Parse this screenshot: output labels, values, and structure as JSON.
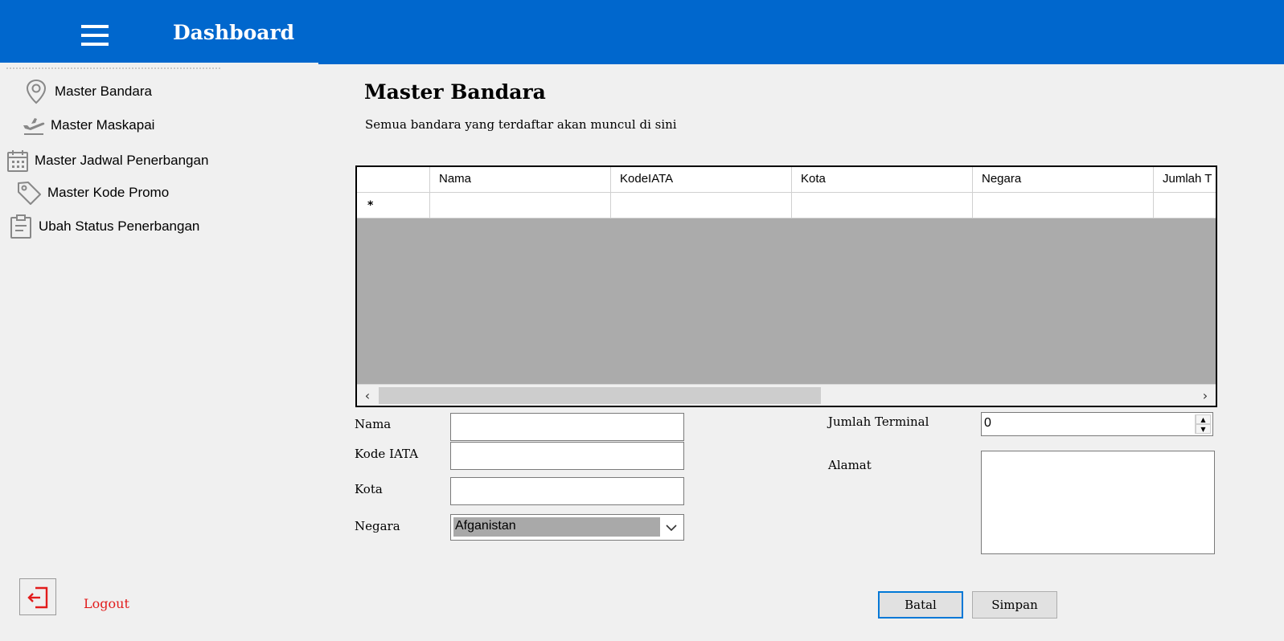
{
  "header": {
    "title": "Dashboard"
  },
  "sidebar": {
    "items": [
      {
        "label": "Master Bandara",
        "icon": "location-pin-icon"
      },
      {
        "label": "Master Maskapai",
        "icon": "plane-departure-icon"
      },
      {
        "label": "Master Jadwal Penerbangan",
        "icon": "calendar-icon"
      },
      {
        "label": "Master Kode Promo",
        "icon": "tag-icon"
      },
      {
        "label": "Ubah Status Penerbangan",
        "icon": "clipboard-icon"
      }
    ],
    "logout_label": "Logout"
  },
  "main": {
    "title": "Master Bandara",
    "subtitle": "Semua bandara yang terdaftar akan muncul di sini",
    "grid": {
      "columns": [
        "Nama",
        "KodeIATA",
        "Kota",
        "Negara",
        "Jumlah T"
      ],
      "new_row_marker": "*"
    },
    "form": {
      "nama_label": "Nama",
      "nama_value": "",
      "kode_iata_label": "Kode IATA",
      "kode_iata_value": "",
      "kota_label": "Kota",
      "kota_value": "",
      "negara_label": "Negara",
      "negara_value": "Afganistan",
      "jumlah_terminal_label": "Jumlah Terminal",
      "jumlah_terminal_value": "0",
      "alamat_label": "Alamat",
      "alamat_value": ""
    },
    "buttons": {
      "batal": "Batal",
      "simpan": "Simpan"
    }
  },
  "colors": {
    "header_bg": "#0067cd",
    "logout_text": "#e21c1c",
    "grid_bg": "#ababab"
  }
}
